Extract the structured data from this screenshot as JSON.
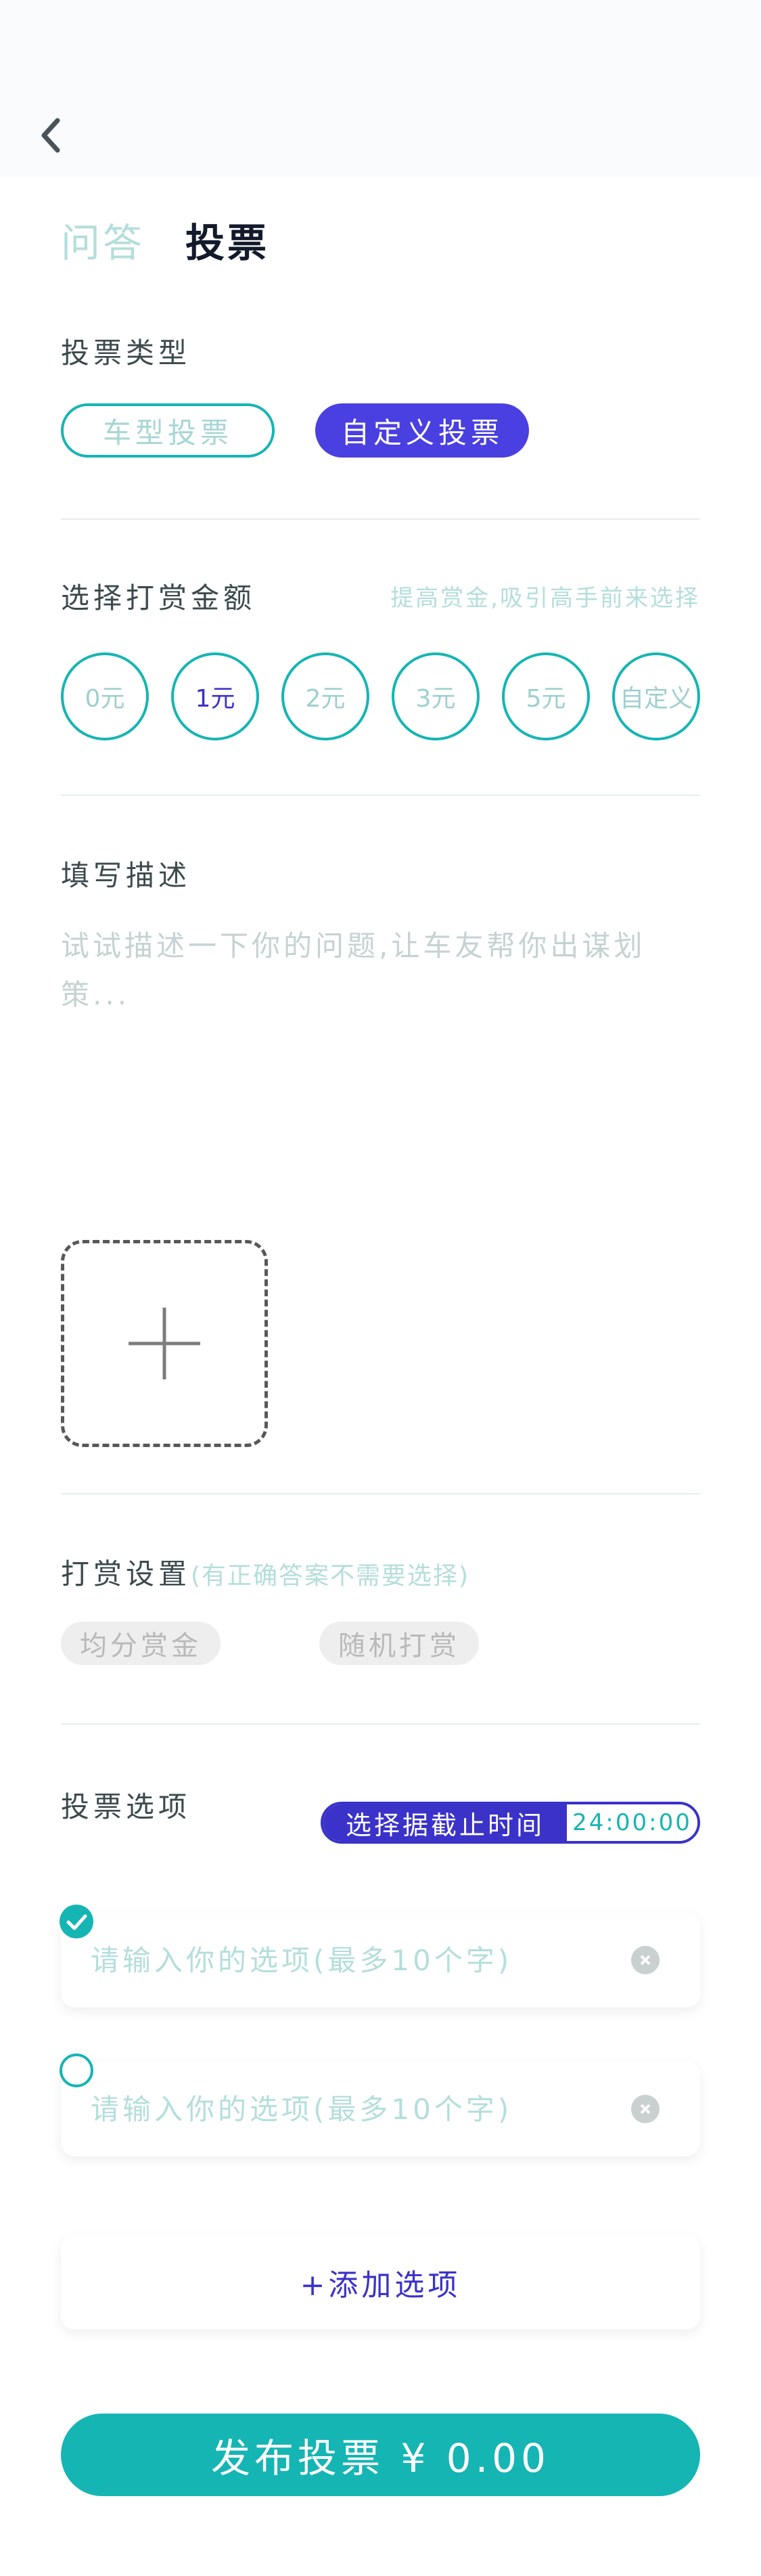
{
  "header": {
    "back_icon": "chevron-left-icon"
  },
  "tabs": [
    {
      "label": "问答",
      "active": false
    },
    {
      "label": "投票",
      "active": true
    }
  ],
  "vote_type": {
    "label": "投票类型",
    "options": [
      {
        "label": "车型投票",
        "selected": false
      },
      {
        "label": "自定义投票",
        "selected": true
      }
    ]
  },
  "reward": {
    "label": "选择打赏金额",
    "hint": "提高赏金,吸引高手前来选择",
    "amounts": [
      {
        "label": "0元",
        "selected": false
      },
      {
        "label": "1元",
        "selected": true
      },
      {
        "label": "2元",
        "selected": false
      },
      {
        "label": "3元",
        "selected": false
      },
      {
        "label": "5元",
        "selected": false
      },
      {
        "label": "自定义",
        "selected": false
      }
    ]
  },
  "description": {
    "label": "填写描述",
    "placeholder": "试试描述一下你的问题,让车友帮你出谋划策..."
  },
  "reward_settings": {
    "label": "打赏设置",
    "hint": "(有正确答案不需要选择)",
    "options": [
      "均分赏金",
      "随机打赏"
    ]
  },
  "vote_options": {
    "label": "投票选项",
    "deadline_label": "选择据截止时间",
    "deadline_value": "24:00:00",
    "items": [
      {
        "placeholder": "请输入你的选项(最多10个字)",
        "checked": true
      },
      {
        "placeholder": "请输入你的选项(最多10个字)",
        "checked": false
      }
    ],
    "add_label": "+添加选项"
  },
  "publish_label": "发布投票 ¥ 0.00",
  "colors": {
    "teal": "#15b5b4",
    "indigo": "#3a32c9",
    "pale_teal": "#b4dedb"
  }
}
